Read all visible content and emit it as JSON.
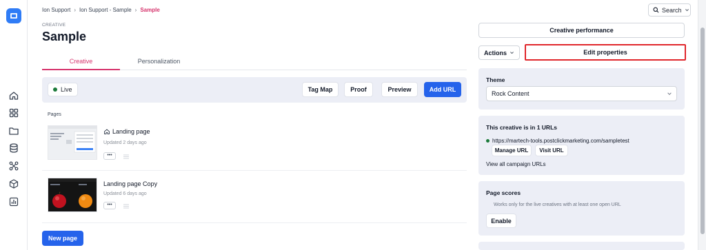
{
  "breadcrumb": [
    {
      "label": "Ion Support"
    },
    {
      "label": "Ion Support - Sample"
    },
    {
      "label": "Sample"
    }
  ],
  "search": {
    "label": "Search"
  },
  "header": {
    "eyebrow": "CREATIVE",
    "title": "Sample"
  },
  "tabs": [
    {
      "label": "Creative",
      "active": true
    },
    {
      "label": "Personalization",
      "active": false
    }
  ],
  "toolbar": {
    "status": "Live",
    "status_color": "#1b7a3a",
    "tag_map": "Tag Map",
    "proof": "Proof",
    "preview": "Preview",
    "add_url": "Add URL"
  },
  "pages_section": {
    "label": "Pages",
    "pages": [
      {
        "name": "Landing page",
        "updated": "Updated 2 days ago",
        "home_icon": "home-icon",
        "more": "•••"
      },
      {
        "name": "Landing page Copy",
        "updated": "Updated 6 days ago",
        "more": "•••"
      }
    ],
    "new_page": "New page"
  },
  "right": {
    "performance": "Creative performance",
    "actions": "Actions",
    "edit_properties": "Edit properties",
    "theme": {
      "title": "Theme",
      "value": "Rock Content"
    },
    "urls": {
      "title": "This creative is in 1 URLs",
      "url": "https://martech-tools.postclickmarketing.com/sampletest",
      "manage": "Manage URL",
      "visit": "Visit URL",
      "view_all": "View all campaign URLs"
    },
    "scores": {
      "title": "Page scores",
      "note": "Works only for the live creatives with at least one open URL",
      "enable": "Enable"
    }
  },
  "colors": {
    "accent": "#d6336c",
    "primary": "#2563eb",
    "highlight": "#e0252a"
  }
}
